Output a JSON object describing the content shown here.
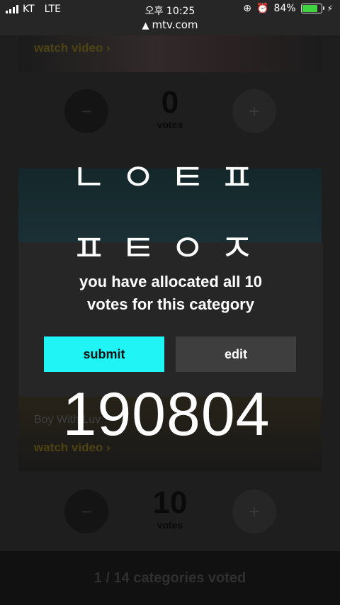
{
  "status_bar": {
    "carrier": "KT",
    "network": "LTE",
    "time": "오후 10:25",
    "battery": "84%",
    "battery_level": 0.84
  },
  "browser": {
    "url": "mtv.com"
  },
  "cards": [
    {
      "watch_label": "watch video"
    },
    {
      "title": "Boy With Luv",
      "watch_label": "watch video"
    }
  ],
  "vote_counters": [
    {
      "count": "0",
      "unit": "votes"
    },
    {
      "count": "10",
      "unit": "votes"
    }
  ],
  "footer": {
    "text": "1 / 14 categories voted"
  },
  "modal": {
    "message_line1": "you have allocated all 10",
    "message_line2": "votes for this category",
    "submit_label": "submit",
    "edit_label": "edit",
    "submit_color": "#21f4f4"
  },
  "overlay": {
    "line1": "ㄴㅇㅌㅍ",
    "line2": "ㅍㅌㅇㅈ",
    "number": "190804"
  }
}
